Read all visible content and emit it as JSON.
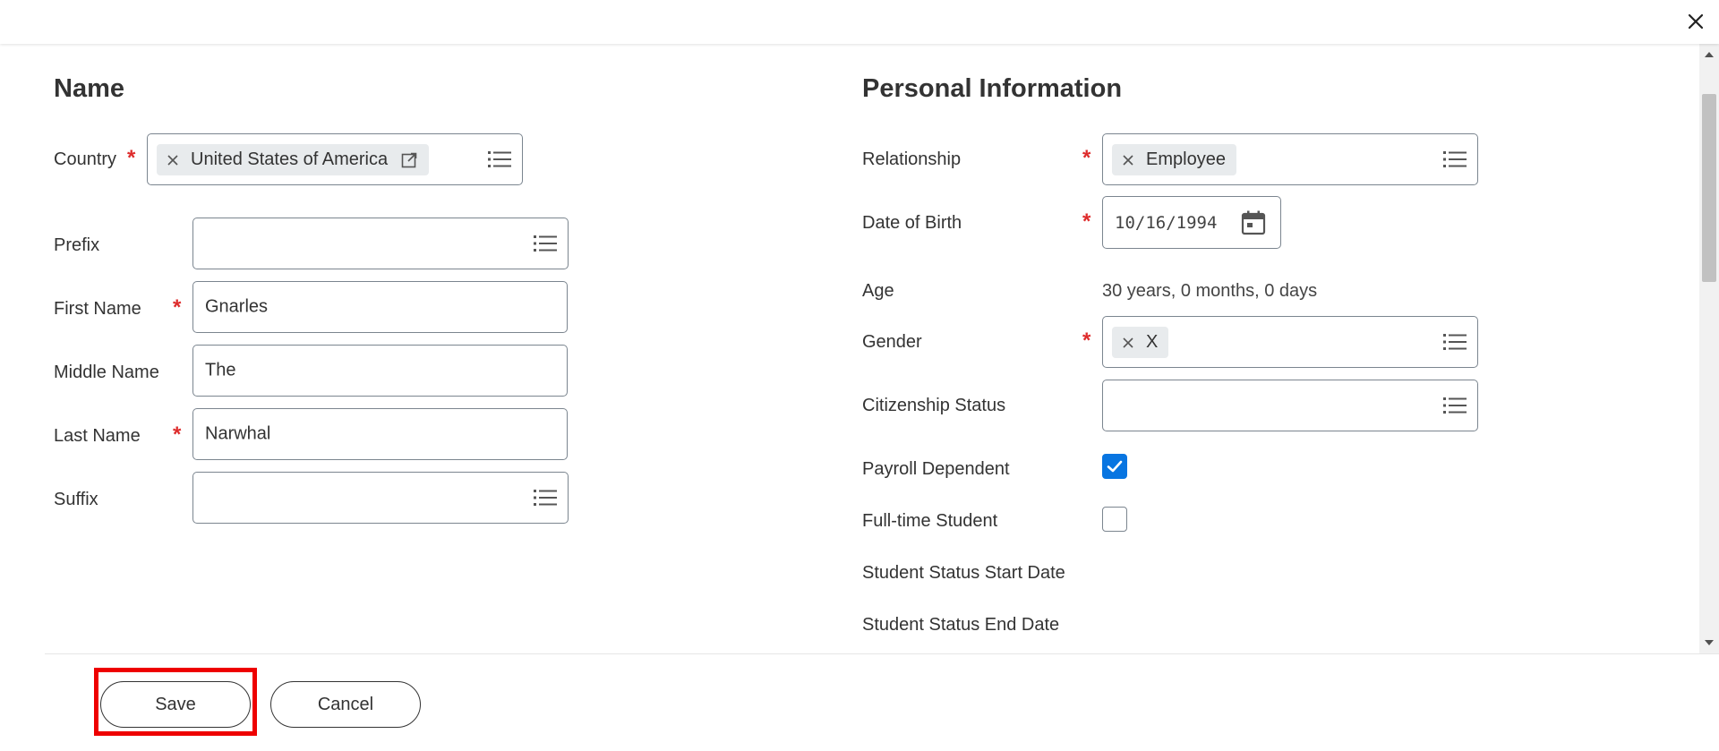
{
  "colors": {
    "accent": "#0875e1",
    "required": "#de2c2c",
    "highlight": "#ee0000"
  },
  "icons": {
    "close": "close-icon",
    "list": "list-icon",
    "remove": "remove-x-icon",
    "external": "external-link-icon",
    "calendar": "calendar-icon",
    "check": "checkmark-icon"
  },
  "name_section": {
    "title": "Name",
    "country": {
      "label": "Country",
      "required": "*",
      "value": "United States of America"
    },
    "prefix": {
      "label": "Prefix",
      "value": ""
    },
    "first_name": {
      "label": "First Name",
      "required": "*",
      "value": "Gnarles"
    },
    "middle_name": {
      "label": "Middle Name",
      "value": "The"
    },
    "last_name": {
      "label": "Last Name",
      "required": "*",
      "value": "Narwhal"
    },
    "suffix": {
      "label": "Suffix",
      "value": ""
    }
  },
  "personal_section": {
    "title": "Personal Information",
    "relationship": {
      "label": "Relationship",
      "required": "*",
      "value": "Employee"
    },
    "date_of_birth": {
      "label": "Date of Birth",
      "required": "*",
      "value": "10/16/1994"
    },
    "age": {
      "label": "Age",
      "value": "30 years, 0 months, 0 days"
    },
    "gender": {
      "label": "Gender",
      "required": "*",
      "value": "X"
    },
    "citizenship_status": {
      "label": "Citizenship Status",
      "value": ""
    },
    "payroll_dependent": {
      "label": "Payroll Dependent",
      "checked": true
    },
    "full_time_student": {
      "label": "Full-time Student",
      "checked": false
    },
    "student_status_start": {
      "label": "Student Status Start Date"
    },
    "student_status_end": {
      "label": "Student Status End Date"
    }
  },
  "footer": {
    "save_label": "Save",
    "cancel_label": "Cancel"
  }
}
